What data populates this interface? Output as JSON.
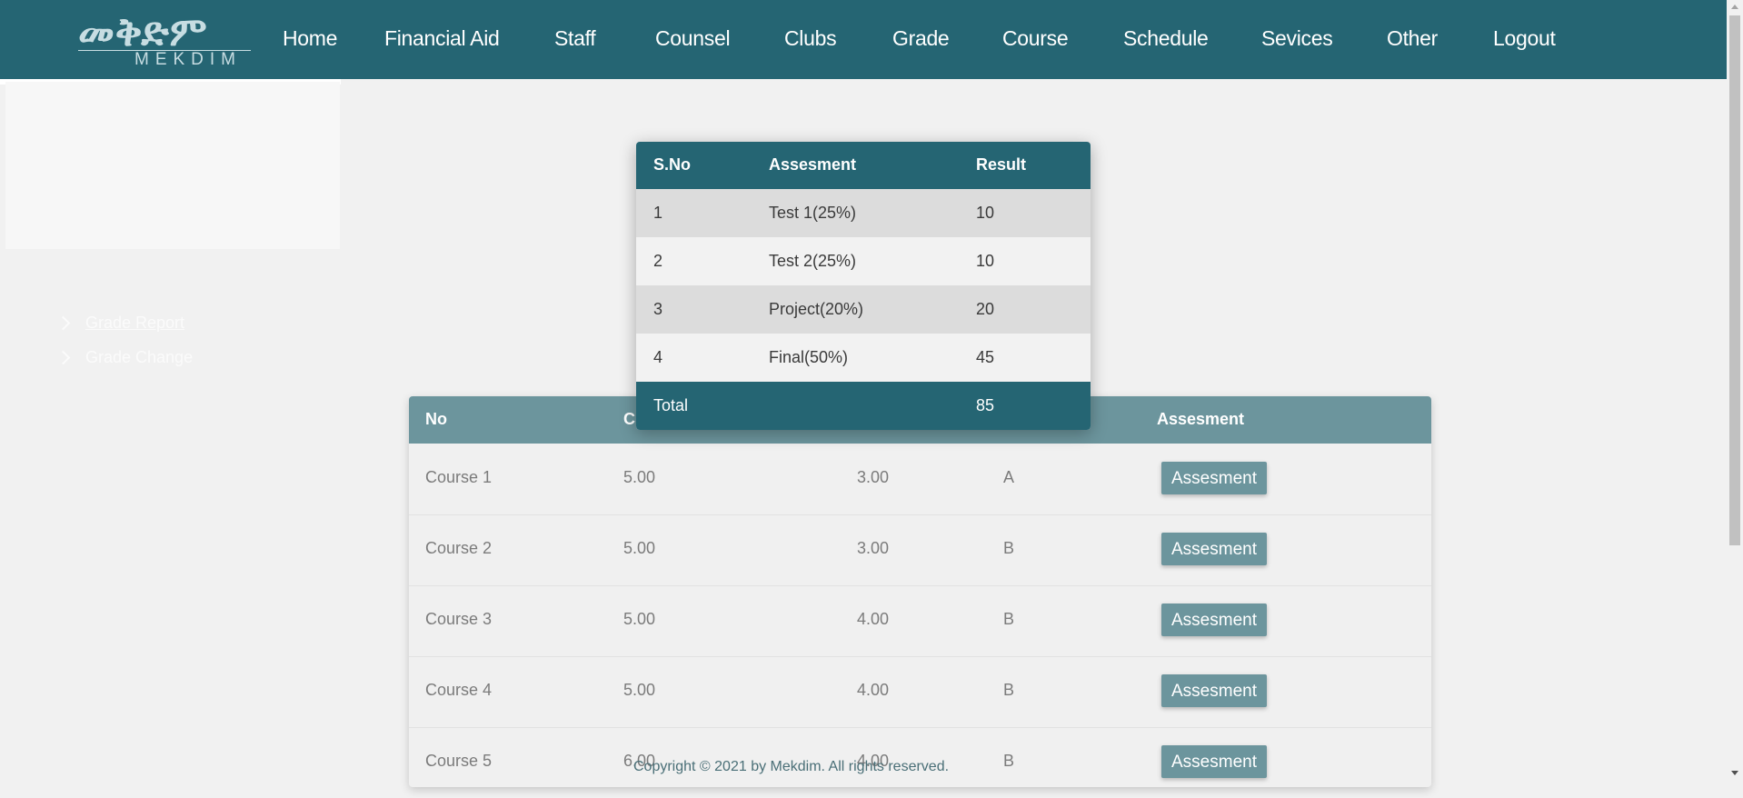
{
  "app": {
    "logo_amharic": "መቅድም",
    "logo_latin": "MEKDIM"
  },
  "nav": {
    "items": [
      "Home",
      "Financial Aid",
      "Staff",
      "Counsel",
      "Clubs",
      "Grade",
      "Course",
      "Schedule",
      "Sevices",
      "Other",
      "Logout"
    ]
  },
  "sidebar": {
    "links": [
      "Grade Report",
      "Grade Change"
    ]
  },
  "course_table": {
    "headers": [
      "No",
      "Cr",
      "",
      "",
      "Assesment"
    ],
    "rows": [
      {
        "no": "Course 1",
        "col2": "5.00",
        "col3": "3.00",
        "grade": "A",
        "button": "Assesment"
      },
      {
        "no": "Course 2",
        "col2": "5.00",
        "col3": "3.00",
        "grade": "B",
        "button": "Assesment"
      },
      {
        "no": "Course 3",
        "col2": "5.00",
        "col3": "4.00",
        "grade": "B",
        "button": "Assesment"
      },
      {
        "no": "Course 4",
        "col2": "5.00",
        "col3": "4.00",
        "grade": "B",
        "button": "Assesment"
      },
      {
        "no": "Course 5",
        "col2": "6.00",
        "col3": "4.00",
        "grade": "B",
        "button": "Assesment"
      }
    ]
  },
  "assessment_popup": {
    "headers": [
      "S.No",
      "Assesment",
      "Result"
    ],
    "rows": [
      {
        "sno": "1",
        "assessment": "Test 1(25%)",
        "result": "10"
      },
      {
        "sno": "2",
        "assessment": "Test 2(25%)",
        "result": "10"
      },
      {
        "sno": "3",
        "assessment": "Project(20%)",
        "result": "20"
      },
      {
        "sno": "4",
        "assessment": "Final(50%)",
        "result": "45"
      }
    ],
    "total_label": "Total",
    "total_value": "85"
  },
  "footer": {
    "copyright": "Copyright © 2021 by Mekdim. All rights reserved."
  },
  "colors": {
    "primary": "#256573",
    "table_header": "#6c959d",
    "background": "#f1f1f1"
  }
}
